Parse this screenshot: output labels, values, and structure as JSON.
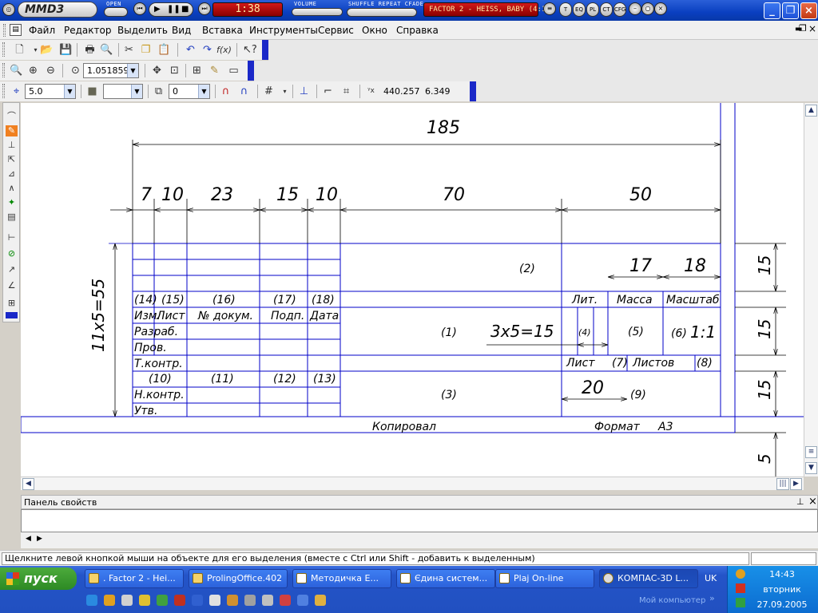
{
  "player": {
    "logo": "MMD3",
    "open_label": "OPEN",
    "volume_label": "VOLUME",
    "shuffle_label": "SHUFFLE REPEAT CFADE",
    "counter": "1:38",
    "track": "FACTOR 2 - HEISS, BABY (4:12)",
    "buttons": [
      "T",
      "EQ",
      "PL",
      "CT",
      "CFG"
    ]
  },
  "menu": [
    "Файл",
    "Редактор",
    "Выделить",
    "Вид",
    "Вставка",
    "Инструменты",
    "Сервис",
    "Окно",
    "Справка"
  ],
  "toolbar": {
    "zoom_value": "1.051859",
    "step_value": "5.0",
    "layer_value": "0",
    "coord_x": "440.257",
    "coord_y": "6.349"
  },
  "drawing": {
    "dims_top": {
      "total": "185",
      "d7": "7",
      "d10a": "10",
      "d23": "23",
      "d15": "15",
      "d10b": "10",
      "d70": "70",
      "d50": "50"
    },
    "dims_inner": {
      "d17": "17",
      "d18": "18",
      "d20": "20",
      "d3x5": "3x5=15"
    },
    "dims_left": "11x5=55",
    "dims_right": [
      "15",
      "15",
      "15",
      "5"
    ],
    "cells": {
      "c14": "(14)",
      "c15": "(15)",
      "c16": "(16)",
      "c17": "(17)",
      "c18": "(18)",
      "izm": "Изм.",
      "list": "Лист",
      "ndoc": "№ докум.",
      "podp": "Подп.",
      "data": "Дата",
      "razrab": "Разраб.",
      "prov": "Пров.",
      "tkontr": "Т.контр.",
      "c10": "(10)",
      "c11": "(11)",
      "c12": "(12)",
      "c13": "(13)",
      "nkontr": "Н.контр.",
      "utv": "Утв.",
      "c1": "(1)",
      "c2": "(2)",
      "c3": "(3)",
      "c4": "(4)",
      "c5": "(5)",
      "c6": "(6)",
      "c7": "(7)",
      "c8": "(8)",
      "c9": "(9)",
      "lit": "Лит.",
      "massa": "Масса",
      "masshtab": "Масштаб",
      "list2": "Лист",
      "listov": "Листов",
      "v11": "1:1"
    },
    "bottom_left": "Копировал",
    "bottom_right": "Формат",
    "format_value": "А3"
  },
  "properties_panel": {
    "title": "Панель свойств"
  },
  "status": {
    "hint": "Щелкните левой кнопкой мыши на объекте для его выделения (вместе с Ctrl или Shift - добавить к выделенным)"
  },
  "taskbar": {
    "start": "пуск",
    "items": [
      ". Factor 2 - Hei...",
      "ProlingOffice.402",
      "Методичка Е...",
      "Єдина систем...",
      "Plaj On-line",
      "КОМПАС-3D L..."
    ],
    "lang": "UK",
    "mycomputer": "Мой компьютер",
    "time": "14:43",
    "day": "вторник",
    "date": "27.09.2005"
  }
}
